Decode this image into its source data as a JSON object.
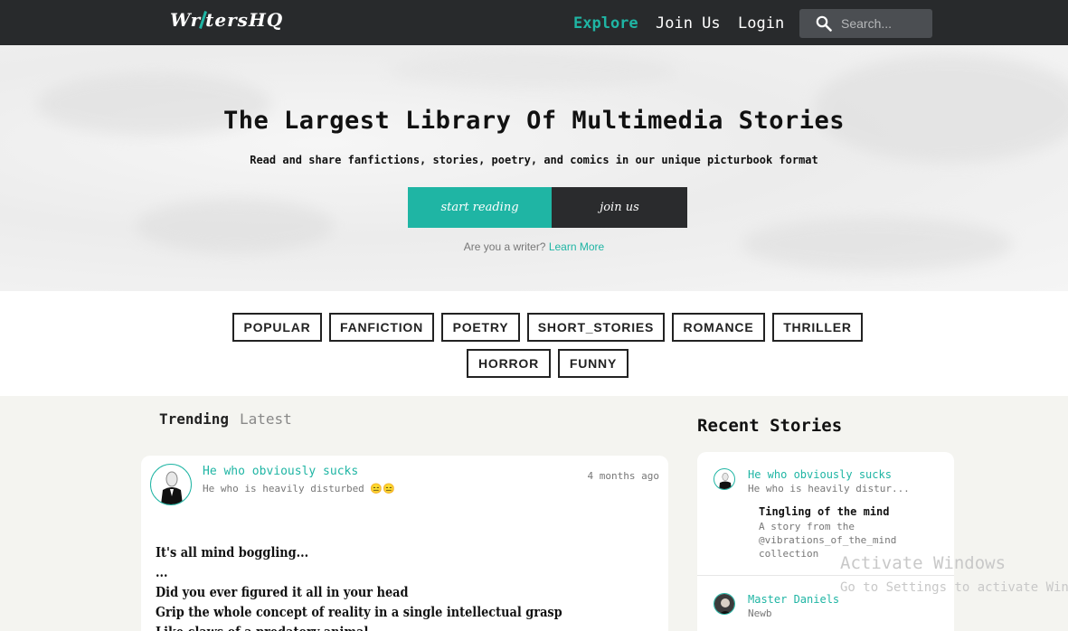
{
  "nav": {
    "logo": "WrtersHQ",
    "links": [
      "Explore",
      "Join Us",
      "Login"
    ],
    "search_placeholder": "Search..."
  },
  "hero": {
    "title": "The Largest Library Of Multimedia Stories",
    "subtitle": "Read and share fanfictions, stories, poetry, and comics in our unique picturbook format",
    "start_label": "start reading",
    "join_label": "join us",
    "writer_question": "Are you a writer?",
    "learn_more": "Learn More"
  },
  "tags": [
    "POPULAR",
    "FANFICTION",
    "POETRY",
    "SHORT_STORIES",
    "ROMANCE",
    "THRILLER",
    "HORROR",
    "FUNNY"
  ],
  "feed": {
    "tabs": [
      "Trending",
      "Latest"
    ],
    "post": {
      "author": "He who obviously sucks",
      "bio": "He who is heavily disturbed 😑😑",
      "time": "4 months ago",
      "lines": [
        "It's all mind boggling...",
        "...",
        "Did you ever figured it all in your head",
        "Grip the whole concept of reality in a single intellectual grasp",
        "Like claws of a predatory animal"
      ]
    }
  },
  "recent": {
    "title": "Recent Stories",
    "items": [
      {
        "author": "He who obviously sucks",
        "bio": "He who is heavily distur...",
        "story_title": "Tingling of the mind",
        "story_desc": "A story from the @vibrations_of_the_mind collection"
      },
      {
        "author": "Master Daniels",
        "bio": "Newb"
      }
    ]
  },
  "watermark": {
    "line1": "Activate Windows",
    "line2": "Go to Settings to activate Windows."
  },
  "colors": {
    "accent": "#1fb5a4",
    "nav_bg": "#282a2c",
    "dark_button": "#2a2b2d"
  }
}
